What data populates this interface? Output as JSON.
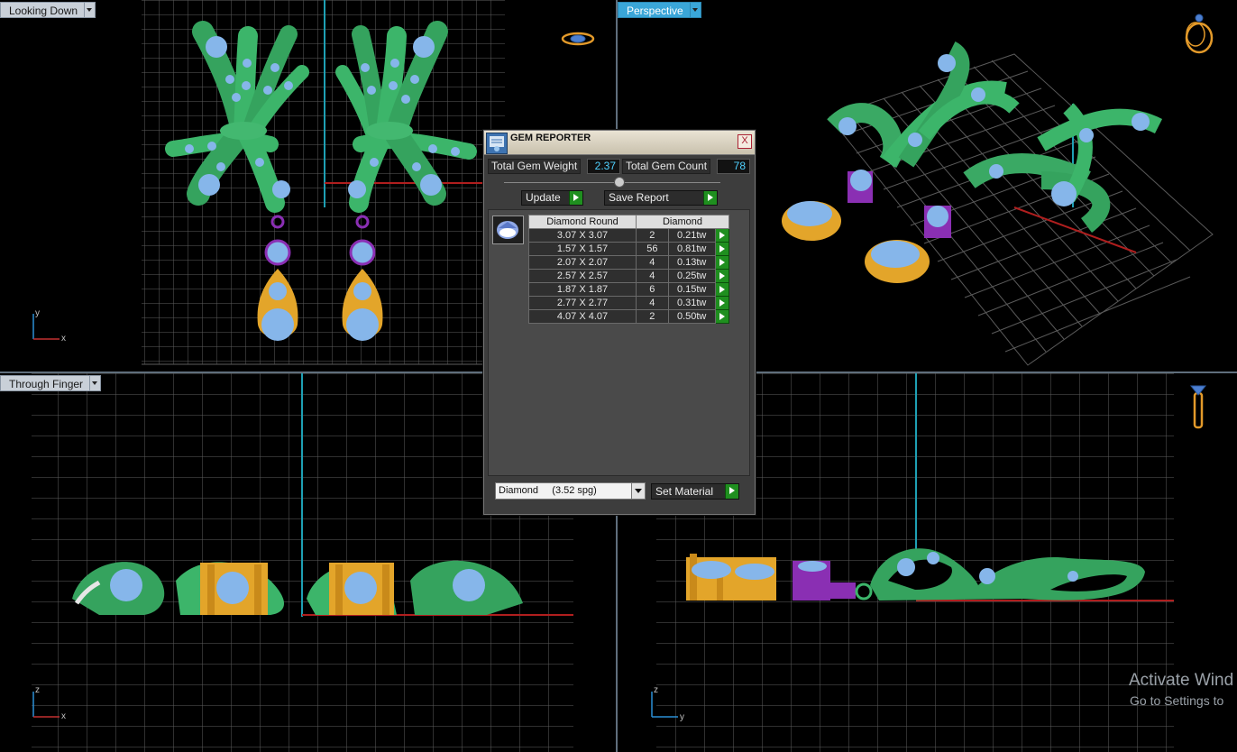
{
  "viewports": {
    "top_left": {
      "label": "Looking Down"
    },
    "top_right": {
      "label": "Perspective"
    },
    "bottom_left": {
      "label": "Through Finger"
    },
    "bottom_right": {
      "label": ""
    }
  },
  "axes": {
    "top_left": {
      "v": "y",
      "h": "x"
    },
    "bottom_left": {
      "v": "z",
      "h": "x"
    },
    "bottom_right": {
      "v": "z",
      "h": "y"
    }
  },
  "gem_reporter": {
    "title": "GEM REPORTER",
    "close_glyph": "X",
    "total_weight_label": "Total Gem Weight",
    "total_weight_value": "2.37",
    "total_count_label": "Total Gem Count",
    "total_count_value": "78",
    "update_label": "Update",
    "save_report_label": "Save Report",
    "table": {
      "header_cut": "Diamond Round",
      "header_material": "Diamond",
      "rows": [
        {
          "size": "3.07 X 3.07",
          "count": "2",
          "weight": "0.21tw"
        },
        {
          "size": "1.57 X 1.57",
          "count": "56",
          "weight": "0.81tw"
        },
        {
          "size": "2.07 X 2.07",
          "count": "4",
          "weight": "0.13tw"
        },
        {
          "size": "2.57 X 2.57",
          "count": "4",
          "weight": "0.25tw"
        },
        {
          "size": "1.87 X 1.87",
          "count": "6",
          "weight": "0.15tw"
        },
        {
          "size": "2.77 X 2.77",
          "count": "4",
          "weight": "0.31tw"
        },
        {
          "size": "4.07 X 4.07",
          "count": "2",
          "weight": "0.50tw"
        }
      ]
    },
    "material_select": "Diamond     (3.52 spg)",
    "set_material_label": "Set Material"
  },
  "watermark": {
    "line1": "Activate Wind",
    "line2": "Go to Settings to"
  },
  "colors": {
    "active_label": "#3aa6d8",
    "grid": "#6e6e6e",
    "metal_green": "#3fae67",
    "metal_gold": "#e3a52a",
    "metal_purple": "#8a2fb3",
    "gem_blue": "#86b6ea",
    "go_button": "#1f8f1f"
  },
  "icons": [
    "ring-top-icon",
    "ring-perspective-icon",
    "ring-side-icon",
    "gem-icon",
    "gem-reporter-icon"
  ]
}
